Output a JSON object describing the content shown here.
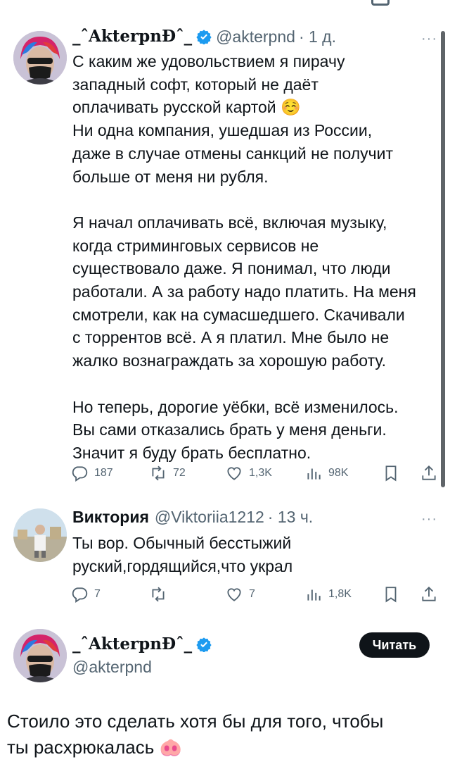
{
  "tweet1": {
    "display_name": "_ˆAkterpnĐˆ_",
    "handle": "@akterpnd",
    "time": "· 1 д.",
    "more": "···",
    "text": "С каким же удовольствием я пирачу\nзападный софт, который не даёт\nоплачивать русской картой ☺️\nНи одна компания, ушедшая из России,\nдаже в случае отмены санкций не получит\nбольше от меня ни рубля.\n\nЯ начал оплачивать всё, включая музыку,\nкогда стриминговых сервисов не\nсуществовало даже. Я понимал, что люди\nработали. А за работу надо платить. На меня\nсмотрели, как на сумасшедшего. Скачивали\nс торрентов всё. А я платил. Мне было не\nжалко вознаграждать за хорошую работу.\n\nНо теперь, дорогие уёбки, всё изменилось.\nВы сами отказались брать у меня деньги.\nЗначит я буду брать бесплатно.",
    "stats": {
      "replies": "187",
      "retweets": "72",
      "likes": "1,3K",
      "views": "98K"
    }
  },
  "tweet2": {
    "display_name": "Виктория",
    "handle": "@Viktoriia1212",
    "time": "· 13 ч.",
    "more": "···",
    "text": "Ты вор. Обычный бесстыжий\nруский,гордящийся,что украл",
    "stats": {
      "replies": "7",
      "retweets": "",
      "likes": "7",
      "views": "1,8K"
    }
  },
  "tweet3": {
    "display_name": "_ˆAkterpnĐˆ_",
    "handle": "@akterpnd",
    "follow_label": "Читать",
    "text": "Стоило это сделать хотя бы для того, чтобы\nты расхрюкалась 🐽"
  },
  "colors": {
    "text": "#0f1419",
    "secondary": "#536471",
    "verified": "#1d9bf0",
    "button": "#0f1419"
  },
  "icons": [
    "reply-icon",
    "retweet-icon",
    "like-icon",
    "views-icon",
    "bookmark-icon",
    "share-icon",
    "verified-badge-icon",
    "more-icon"
  ]
}
